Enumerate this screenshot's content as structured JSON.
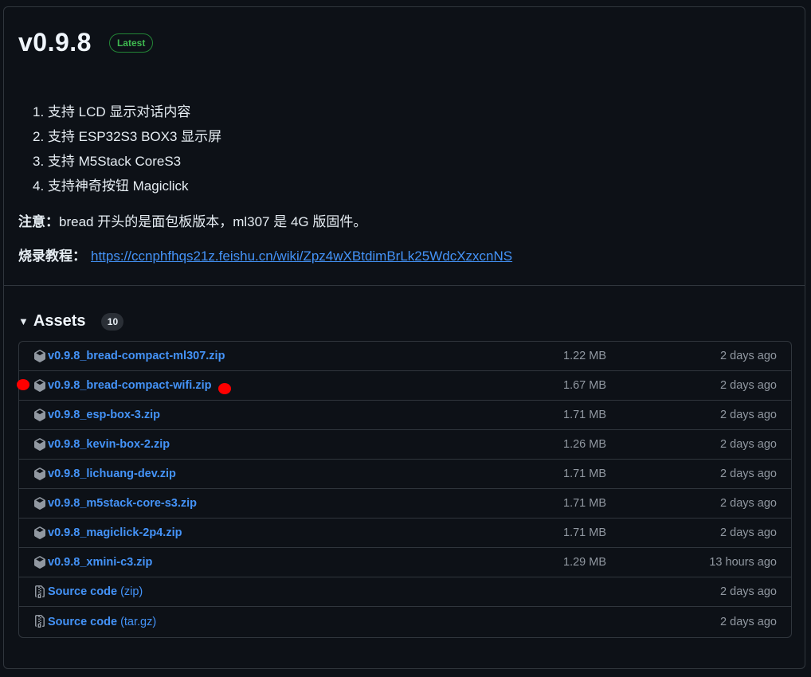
{
  "release": {
    "version": "v0.9.8",
    "badge": "Latest"
  },
  "notes": [
    "1. 支持 LCD 显示对话内容",
    "2. 支持 ESP32S3 BOX3 显示屏",
    "3. 支持 M5Stack CoreS3",
    "4. 支持神奇按钮 Magiclick"
  ],
  "notice": {
    "label": "注意：",
    "text": "bread 开头的是面包板版本，ml307 是 4G 版固件。"
  },
  "tutorial": {
    "label": "烧录教程：",
    "link": "https://ccnphfhqs21z.feishu.cn/wiki/Zpz4wXBtdimBrLk25WdcXzxcnNS"
  },
  "assets": {
    "title": "Assets",
    "count": "10",
    "items": [
      {
        "name": "v0.9.8_bread-compact-ml307.zip",
        "sub": "",
        "size": "1.22 MB",
        "date": "2 days ago",
        "icon": "package-icon"
      },
      {
        "name": "v0.9.8_bread-compact-wifi.zip",
        "sub": "",
        "size": "1.67 MB",
        "date": "2 days ago",
        "icon": "package-icon"
      },
      {
        "name": "v0.9.8_esp-box-3.zip",
        "sub": "",
        "size": "1.71 MB",
        "date": "2 days ago",
        "icon": "package-icon"
      },
      {
        "name": "v0.9.8_kevin-box-2.zip",
        "sub": "",
        "size": "1.26 MB",
        "date": "2 days ago",
        "icon": "package-icon"
      },
      {
        "name": "v0.9.8_lichuang-dev.zip",
        "sub": "",
        "size": "1.71 MB",
        "date": "2 days ago",
        "icon": "package-icon"
      },
      {
        "name": "v0.9.8_m5stack-core-s3.zip",
        "sub": "",
        "size": "1.71 MB",
        "date": "2 days ago",
        "icon": "package-icon"
      },
      {
        "name": "v0.9.8_magiclick-2p4.zip",
        "sub": "",
        "size": "1.71 MB",
        "date": "2 days ago",
        "icon": "package-icon"
      },
      {
        "name": "v0.9.8_xmini-c3.zip",
        "sub": "",
        "size": "1.29 MB",
        "date": "13 hours ago",
        "icon": "package-icon"
      },
      {
        "name": "Source code",
        "sub": "(zip)",
        "size": "",
        "date": "2 days ago",
        "icon": "file-zip-icon"
      },
      {
        "name": "Source code",
        "sub": "(tar.gz)",
        "size": "",
        "date": "2 days ago",
        "icon": "file-zip-icon"
      }
    ]
  },
  "colors": {
    "background": "#0d1117",
    "link": "#4493f8",
    "latest": "#3fb950",
    "marker": "#ff0000"
  }
}
